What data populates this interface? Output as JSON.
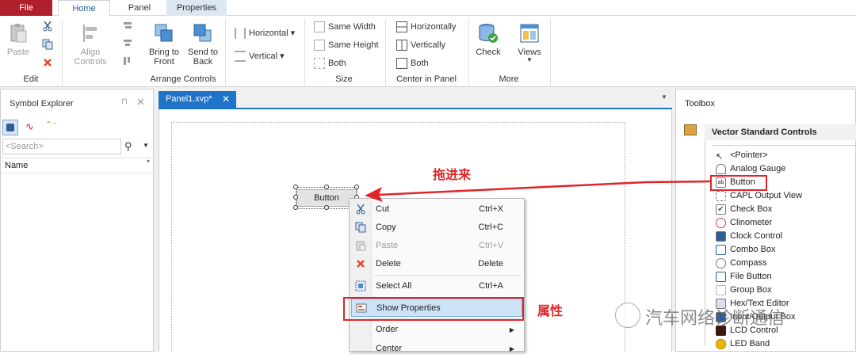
{
  "tabs": {
    "file": "File",
    "home": "Home",
    "panel": "Panel",
    "properties": "Properties"
  },
  "ribbon": {
    "edit": {
      "paste": "Paste",
      "group": "Edit"
    },
    "arrange": {
      "align_line1": "Align",
      "align_line2": "Controls",
      "bring_line1": "Bring to",
      "bring_line2": "Front",
      "send_line1": "Send to",
      "send_line2": "Back",
      "horizontal": "Horizontal",
      "vertical": "Vertical",
      "group": "Arrange Controls"
    },
    "size": {
      "same_width": "Same Width",
      "same_height": "Same Height",
      "both": "Both",
      "group": "Size"
    },
    "center": {
      "horizontally": "Horizontally",
      "vertically": "Vertically",
      "both": "Both",
      "group": "Center in Panel"
    },
    "more": {
      "check": "Check",
      "views": "Views",
      "group": "More"
    }
  },
  "symbol_explorer": {
    "title": "Symbol Explorer",
    "search_placeholder": "<Search>",
    "column_name": "Name"
  },
  "document": {
    "tab_label": "Panel1.xvp*",
    "button_label": "Button"
  },
  "context_menu": [
    {
      "label": "Cut",
      "shortcut": "Ctrl+X",
      "enabled": true,
      "icon": "scissors-icon"
    },
    {
      "label": "Copy",
      "shortcut": "Ctrl+C",
      "enabled": true,
      "icon": "copy-icon"
    },
    {
      "label": "Paste",
      "shortcut": "Ctrl+V",
      "enabled": false,
      "icon": "paste-icon"
    },
    {
      "label": "Delete",
      "shortcut": "Delete",
      "enabled": true,
      "icon": "delete-icon"
    },
    {
      "label": "Select All",
      "shortcut": "Ctrl+A",
      "enabled": true,
      "icon": "select-all-icon"
    },
    {
      "label": "Show Properties",
      "shortcut": "",
      "enabled": true,
      "icon": "properties-icon",
      "highlighted": true
    },
    {
      "label": "Order",
      "shortcut": "",
      "enabled": true,
      "submenu": true
    },
    {
      "label": "Center",
      "shortcut": "",
      "enabled": true,
      "submenu": true
    }
  ],
  "toolbox": {
    "title": "Toolbox",
    "category": "Vector Standard Controls",
    "items": [
      "<Pointer>",
      "Analog Gauge",
      "Button",
      "CAPL Output View",
      "Check Box",
      "Clinometer",
      "Clock Control",
      "Combo Box",
      "Compass",
      "File Button",
      "Group Box",
      "Hex/Text Editor",
      "Input/Output Box",
      "LCD Control",
      "LED Band"
    ]
  },
  "annotations": {
    "drag_in": "拖进来",
    "properties": "属性",
    "watermark": "汽车网络诊断通信"
  },
  "colors": {
    "file_tab": "#b11f2c",
    "accent_blue": "#1f73c8",
    "annotation_red": "#e0252a",
    "menu_highlight": "#cde3f7"
  }
}
